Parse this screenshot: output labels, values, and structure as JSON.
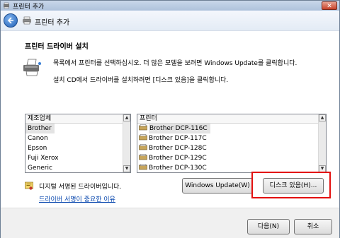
{
  "window": {
    "title": "프린터 추가",
    "close_label": "✕"
  },
  "nav": {
    "title": "프린터 추가"
  },
  "page": {
    "heading": "프린터 드라이버 설치",
    "instruction1": "목록에서 프린터를 선택하십시오. 더 많은 모델을 보려면 Windows Update를 클릭합니다.",
    "instruction2": "설치 CD에서 드라이버를 설치하려면 [디스크 있음]을 클릭합니다."
  },
  "manufacturers": {
    "header": "제조업체",
    "items": [
      "Brother",
      "Canon",
      "Epson",
      "Fuji Xerox",
      "Generic"
    ],
    "selected": "Brother"
  },
  "printers": {
    "header": "프린터",
    "items": [
      "Brother DCP-116C",
      "Brother DCP-117C",
      "Brother DCP-128C",
      "Brother DCP-129C",
      "Brother DCP-130C"
    ],
    "selected": "Brother DCP-116C"
  },
  "signature": {
    "status": "디지털 서명된 드라이버입니다.",
    "link": "드라이버 서명이 중요한 이유"
  },
  "buttons": {
    "windows_update": "Windows Update(W)",
    "have_disk": "디스크 있음(H)...",
    "next": "다음(N)",
    "cancel": "취소"
  },
  "colors": {
    "highlight": "#e3100f",
    "link": "#0645ad"
  }
}
